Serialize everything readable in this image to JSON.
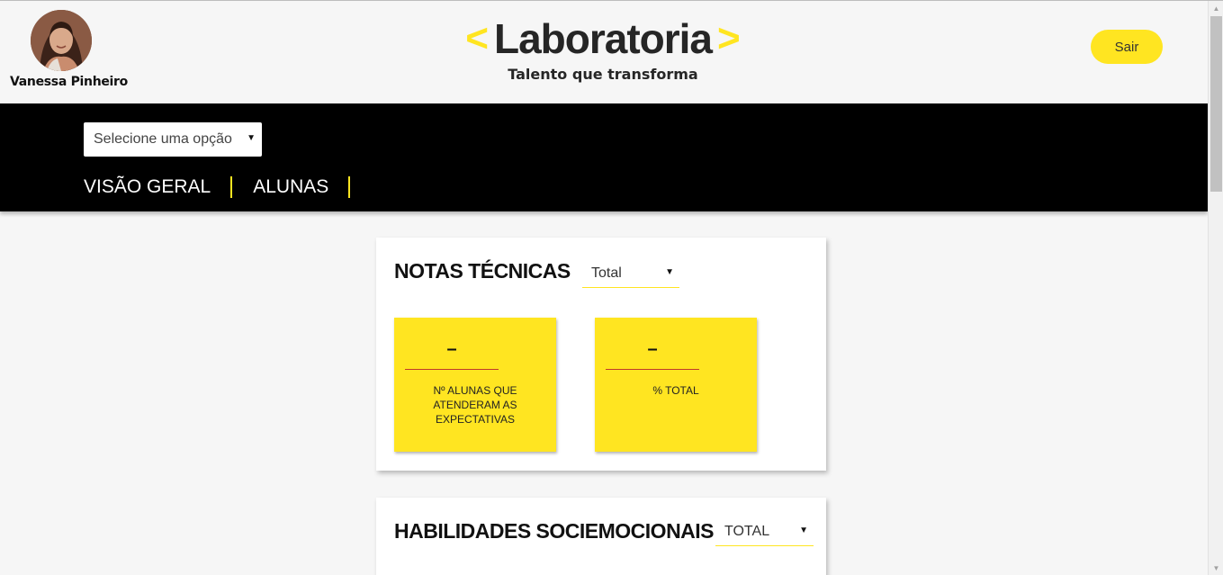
{
  "header": {
    "user_name": "Vanessa Pinheiro",
    "logo_chevron_left": "<",
    "logo_text": "Laboratoria",
    "logo_chevron_right": ">",
    "tagline": "Talento que transforma",
    "logout_label": "Sair"
  },
  "nav": {
    "cohort_select_value": "Selecione uma opção",
    "tabs": [
      {
        "label": "VISÃO GERAL"
      },
      {
        "label": "ALUNAS"
      }
    ]
  },
  "notas_tecnicas": {
    "title": "NOTAS TÉCNICAS",
    "filter_value": "Total",
    "stats": [
      {
        "value": "–",
        "label": "Nº ALUNAS QUE ATENDERAM AS EXPECTATIVAS"
      },
      {
        "value": "–",
        "label": "% TOTAL"
      }
    ]
  },
  "habilidades": {
    "title": "HABILIDADES SOCIEMOCIONAIS",
    "filter_value": "TOTAL"
  },
  "colors": {
    "brand_yellow": "#ffe521",
    "nav_background": "#000000",
    "page_background": "#f6f6f6",
    "stat_underline": "#c0392b"
  },
  "icons": {
    "dropdown": "caret-down-icon",
    "scroll_up": "arrow-up-icon",
    "scroll_down": "arrow-down-icon"
  }
}
